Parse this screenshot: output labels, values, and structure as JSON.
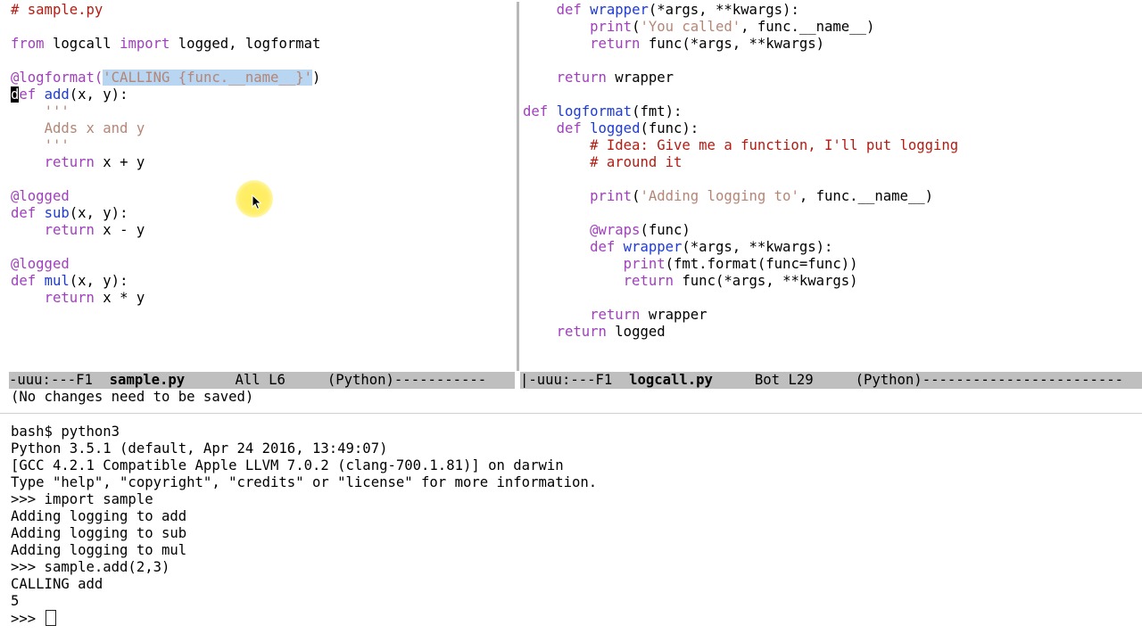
{
  "editor": {
    "left_pane": {
      "lines": [
        [
          {
            "t": "# sample.py",
            "c": "c"
          }
        ],
        [
          {
            "t": ""
          }
        ],
        [
          {
            "t": "from",
            "c": "k"
          },
          {
            "t": " logcall "
          },
          {
            "t": "import",
            "c": "k"
          },
          {
            "t": " logged, logformat"
          }
        ],
        [
          {
            "t": ""
          }
        ],
        [
          {
            "t": "@logformat(",
            "c": "dec"
          },
          {
            "t": "'CALLING {func.__name__}'",
            "c": "s",
            "hl": true
          },
          {
            "t": ")"
          }
        ],
        [
          {
            "t": "d",
            "cur": true
          },
          {
            "t": "ef",
            "c": "k"
          },
          {
            "t": " "
          },
          {
            "t": "add",
            "c": "f"
          },
          {
            "t": "(x, y):"
          }
        ],
        [
          {
            "t": "    "
          },
          {
            "t": "'''",
            "c": "s"
          }
        ],
        [
          {
            "t": "    "
          },
          {
            "t": "Adds x and y",
            "c": "s"
          }
        ],
        [
          {
            "t": "    "
          },
          {
            "t": "'''",
            "c": "s"
          }
        ],
        [
          {
            "t": "    "
          },
          {
            "t": "return",
            "c": "k"
          },
          {
            "t": " x + y"
          }
        ],
        [
          {
            "t": ""
          }
        ],
        [
          {
            "t": "@logged",
            "c": "dec"
          }
        ],
        [
          {
            "t": "def",
            "c": "k"
          },
          {
            "t": " "
          },
          {
            "t": "sub",
            "c": "f"
          },
          {
            "t": "(x, y):"
          }
        ],
        [
          {
            "t": "    "
          },
          {
            "t": "return",
            "c": "k"
          },
          {
            "t": " x - y"
          }
        ],
        [
          {
            "t": ""
          }
        ],
        [
          {
            "t": "@logged",
            "c": "dec"
          }
        ],
        [
          {
            "t": "def",
            "c": "k"
          },
          {
            "t": " "
          },
          {
            "t": "mul",
            "c": "f"
          },
          {
            "t": "(x, y):"
          }
        ],
        [
          {
            "t": "    "
          },
          {
            "t": "return",
            "c": "k"
          },
          {
            "t": " x * y"
          }
        ]
      ]
    },
    "right_pane": {
      "lines": [
        [
          {
            "t": "    "
          },
          {
            "t": "def",
            "c": "k"
          },
          {
            "t": " "
          },
          {
            "t": "wrapper",
            "c": "f"
          },
          {
            "t": "(*args, **kwargs):"
          }
        ],
        [
          {
            "t": "        "
          },
          {
            "t": "print",
            "c": "k"
          },
          {
            "t": "("
          },
          {
            "t": "'You called'",
            "c": "s"
          },
          {
            "t": ", func.__name__)"
          }
        ],
        [
          {
            "t": "        "
          },
          {
            "t": "return",
            "c": "k"
          },
          {
            "t": " func(*args, **kwargs)"
          }
        ],
        [
          {
            "t": ""
          }
        ],
        [
          {
            "t": "    "
          },
          {
            "t": "return",
            "c": "k"
          },
          {
            "t": " wrapper"
          }
        ],
        [
          {
            "t": ""
          }
        ],
        [
          {
            "t": "def",
            "c": "k"
          },
          {
            "t": " "
          },
          {
            "t": "logformat",
            "c": "f"
          },
          {
            "t": "(fmt):"
          }
        ],
        [
          {
            "t": "    "
          },
          {
            "t": "def",
            "c": "k"
          },
          {
            "t": " "
          },
          {
            "t": "logged",
            "c": "f"
          },
          {
            "t": "(func):"
          }
        ],
        [
          {
            "t": "        "
          },
          {
            "t": "# Idea: Give me a function, I'll put logging",
            "c": "c"
          }
        ],
        [
          {
            "t": "        "
          },
          {
            "t": "# around it",
            "c": "c"
          }
        ],
        [
          {
            "t": ""
          }
        ],
        [
          {
            "t": "        "
          },
          {
            "t": "print",
            "c": "k"
          },
          {
            "t": "("
          },
          {
            "t": "'Adding logging to'",
            "c": "s"
          },
          {
            "t": ", func.__name__)"
          }
        ],
        [
          {
            "t": ""
          }
        ],
        [
          {
            "t": "        "
          },
          {
            "t": "@wraps",
            "c": "dec"
          },
          {
            "t": "(func)"
          }
        ],
        [
          {
            "t": "        "
          },
          {
            "t": "def",
            "c": "k"
          },
          {
            "t": " "
          },
          {
            "t": "wrapper",
            "c": "f"
          },
          {
            "t": "(*args, **kwargs):"
          }
        ],
        [
          {
            "t": "            "
          },
          {
            "t": "print",
            "c": "k"
          },
          {
            "t": "(fmt.format(func=func))"
          }
        ],
        [
          {
            "t": "            "
          },
          {
            "t": "return",
            "c": "k"
          },
          {
            "t": " func(*args, **kwargs)"
          }
        ],
        [
          {
            "t": ""
          }
        ],
        [
          {
            "t": "        "
          },
          {
            "t": "return",
            "c": "k"
          },
          {
            "t": " wrapper"
          }
        ],
        [
          {
            "t": "    "
          },
          {
            "t": "return",
            "c": "k"
          },
          {
            "t": " logged"
          }
        ]
      ]
    }
  },
  "modelines": {
    "left": {
      "prefix": "-uuu:---F1  ",
      "buffer": "sample.py",
      "position": "All L6",
      "mode": "(Python)",
      "fill": "-----------"
    },
    "right": {
      "prefix": "-uuu:---F1  ",
      "buffer": "logcall.py",
      "position": "Bot L29",
      "mode": "(Python)",
      "fill": "------------------------"
    }
  },
  "echo_area": "(No changes need to be saved)",
  "terminal": {
    "lines": [
      "bash$ python3",
      "Python 3.5.1 (default, Apr 24 2016, 13:49:07)",
      "[GCC 4.2.1 Compatible Apple LLVM 7.0.2 (clang-700.1.81)] on darwin",
      "Type \"help\", \"copyright\", \"credits\" or \"license\" for more information.",
      ">>> import sample",
      "Adding logging to add",
      "Adding logging to sub",
      "Adding logging to mul",
      ">>> sample.add(2,3)",
      "CALLING add",
      "5"
    ],
    "prompt": ">>> "
  }
}
